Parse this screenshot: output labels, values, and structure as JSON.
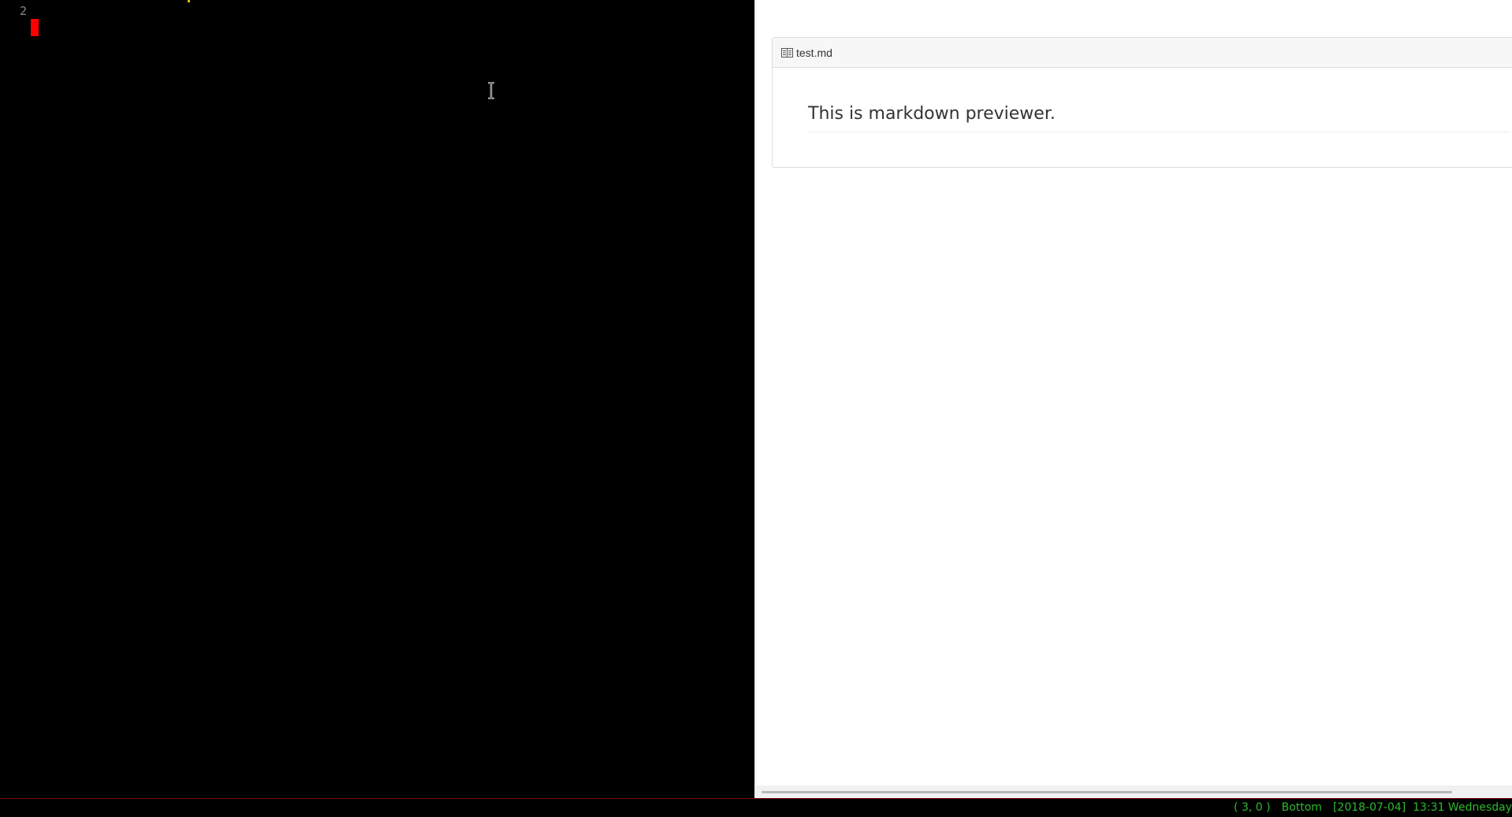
{
  "editor": {
    "lines": [
      {
        "number": "2"
      }
    ]
  },
  "preview": {
    "file_name": "test.md",
    "paragraph": "This is markdown previewer."
  },
  "statusline": {
    "position": "( 3, 0 )",
    "scroll": "Bottom",
    "datetime": "[2018-07-04]  13:31 Wednesday"
  },
  "colors": {
    "editor_background": "#000000",
    "cursor": "#ff0000",
    "status_text": "#2fb82f",
    "status_border": "#7a0000",
    "preview_background": "#ffffff"
  }
}
